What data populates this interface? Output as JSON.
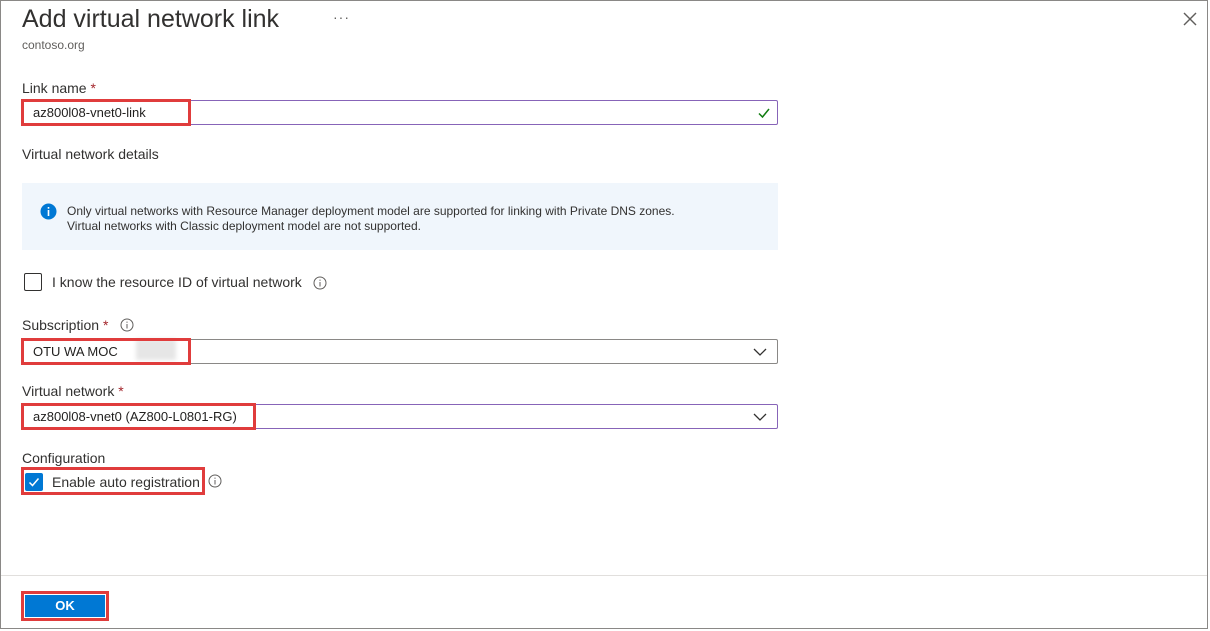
{
  "header": {
    "title": "Add virtual network link",
    "more_glyph": "···",
    "subtitle": "contoso.org",
    "close_icon": "close-icon"
  },
  "link_name": {
    "label": "Link name",
    "required_mark": "*",
    "value": "az800l08-vnet0-link",
    "valid_icon": "checkmark-icon"
  },
  "vnet_details": {
    "heading": "Virtual network details",
    "info_line1": "Only virtual networks with Resource Manager deployment model are supported for linking with Private DNS zones.",
    "info_line2": "Virtual networks with Classic deployment model are not supported."
  },
  "resource_id": {
    "label": "I know the resource ID of virtual network",
    "checked": false
  },
  "subscription": {
    "label": "Subscription",
    "required_mark": "*",
    "value": "OTU WA MOC"
  },
  "virtual_network": {
    "label": "Virtual network",
    "required_mark": "*",
    "value": "az800l08-vnet0 (AZ800-L0801-RG)"
  },
  "configuration": {
    "heading": "Configuration",
    "auto_registration_label": "Enable auto registration",
    "auto_registration_checked": true
  },
  "footer": {
    "ok_label": "OK"
  },
  "colors": {
    "accent": "#0078d4",
    "highlight": "#e03c3c",
    "focus_border": "#8764b8",
    "valid_green": "#107c10",
    "info_background": "#f0f6fc"
  }
}
